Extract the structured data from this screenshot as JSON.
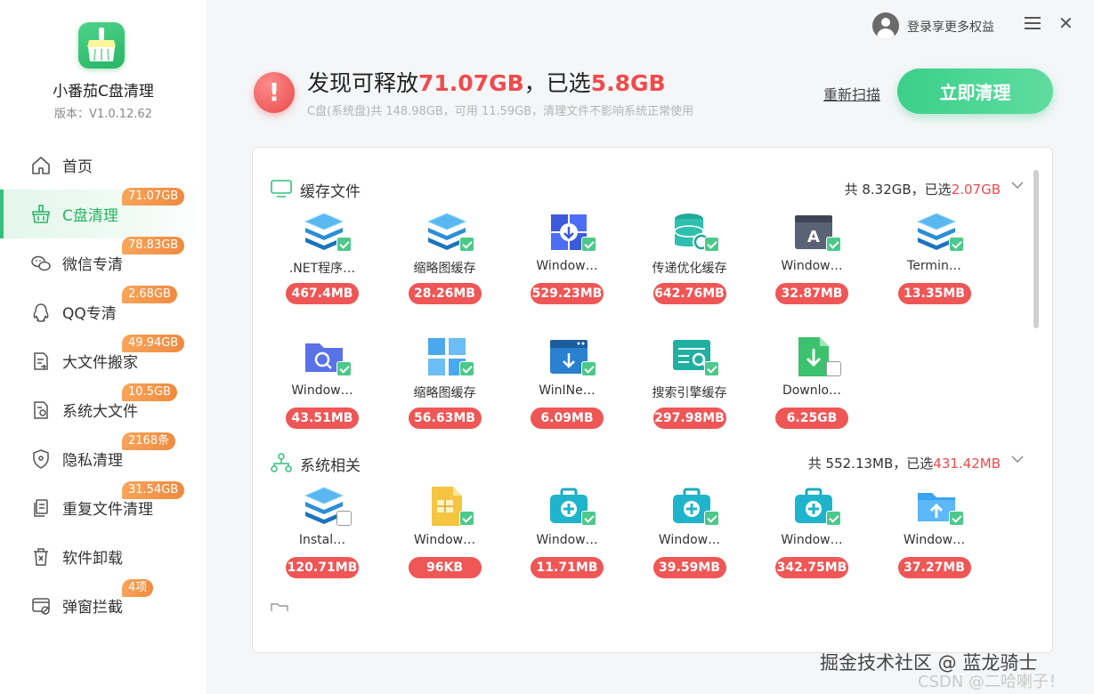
{
  "app": {
    "name": "小番茄C盘清理",
    "version": "版本：V1.0.12.62"
  },
  "sidebar": {
    "items": [
      {
        "label": "首页",
        "badge": "",
        "icon": "home-icon"
      },
      {
        "label": "C盘清理",
        "badge": "71.07GB",
        "icon": "broom-basket-icon"
      },
      {
        "label": "微信专清",
        "badge": "78.83GB",
        "icon": "wechat-icon"
      },
      {
        "label": "QQ专清",
        "badge": "2.68GB",
        "icon": "qq-icon"
      },
      {
        "label": "大文件搬家",
        "badge": "49.94GB",
        "icon": "file-move-icon"
      },
      {
        "label": "系统大文件",
        "badge": "10.5GB",
        "icon": "system-file-icon"
      },
      {
        "label": "隐私清理",
        "badge": "2168条",
        "icon": "shield-icon"
      },
      {
        "label": "重复文件清理",
        "badge": "31.54GB",
        "icon": "duplicate-file-icon"
      },
      {
        "label": "软件卸载",
        "badge": "",
        "icon": "uninstall-icon"
      },
      {
        "label": "弹窗拦截",
        "badge": "4项",
        "icon": "popup-block-icon"
      }
    ]
  },
  "topbar": {
    "login_text": "登录享更多权益"
  },
  "summary": {
    "title_prefix": "发现可释放",
    "total": "71.07GB",
    "title_mid": "，已选",
    "selected": "5.8GB",
    "subtitle": "C盘(系统盘)共 148.98GB，可用 11.59GB，清理文件不影响系统正常使用",
    "rescan": "重新扫描",
    "clean_button": "立即清理"
  },
  "sections": [
    {
      "title": "缓存文件",
      "stats_prefix": "共 8.32GB，已选",
      "stats_selected": "2.07GB",
      "items": [
        {
          "label": ".NET程序…",
          "size": "467.4MB",
          "icon": "layers-icon",
          "checked": true
        },
        {
          "label": "缩略图缓存",
          "size": "28.26MB",
          "icon": "layers-icon",
          "checked": true
        },
        {
          "label": "Window…",
          "size": "529.23MB",
          "icon": "windows-download-icon",
          "checked": true
        },
        {
          "label": "传递优化缓存",
          "size": "642.76MB",
          "icon": "database-refresh-icon",
          "checked": true
        },
        {
          "label": "Window…",
          "size": "32.87MB",
          "icon": "font-window-icon",
          "checked": true
        },
        {
          "label": "Termin…",
          "size": "13.35MB",
          "icon": "layers-icon",
          "checked": true
        },
        {
          "label": "Window…",
          "size": "43.51MB",
          "icon": "folder-search-icon",
          "checked": true
        },
        {
          "label": "缩略图缓存",
          "size": "56.63MB",
          "icon": "thumbnail-grid-icon",
          "checked": true
        },
        {
          "label": "WinINe…",
          "size": "6.09MB",
          "icon": "browser-download-icon",
          "checked": true
        },
        {
          "label": "搜索引擎缓存",
          "size": "297.98MB",
          "icon": "search-engine-icon",
          "checked": true
        },
        {
          "label": "Downlo…",
          "size": "6.25GB",
          "icon": "download-file-icon",
          "checked": false
        }
      ]
    },
    {
      "title": "系统相关",
      "stats_prefix": "共 552.13MB，已选",
      "stats_selected": "431.42MB",
      "items": [
        {
          "label": "Instal…",
          "size": "120.71MB",
          "icon": "layers-icon",
          "checked": false
        },
        {
          "label": "Window…",
          "size": "96KB",
          "icon": "zip-file-icon",
          "checked": true
        },
        {
          "label": "Window…",
          "size": "11.71MB",
          "icon": "toolbox-icon",
          "checked": true
        },
        {
          "label": "Window…",
          "size": "39.59MB",
          "icon": "toolbox-icon",
          "checked": true
        },
        {
          "label": "Window…",
          "size": "342.75MB",
          "icon": "toolbox-icon",
          "checked": true
        },
        {
          "label": "Window…",
          "size": "37.27MB",
          "icon": "folder-upload-icon",
          "checked": true
        }
      ]
    }
  ],
  "watermark": {
    "line1": "掘金技术社区 @ 蓝龙骑士",
    "line2": "CSDN @二哈喇子！"
  },
  "colors": {
    "accent": "#35c07a",
    "danger": "#ef5656",
    "badge": "#f08a3f"
  }
}
